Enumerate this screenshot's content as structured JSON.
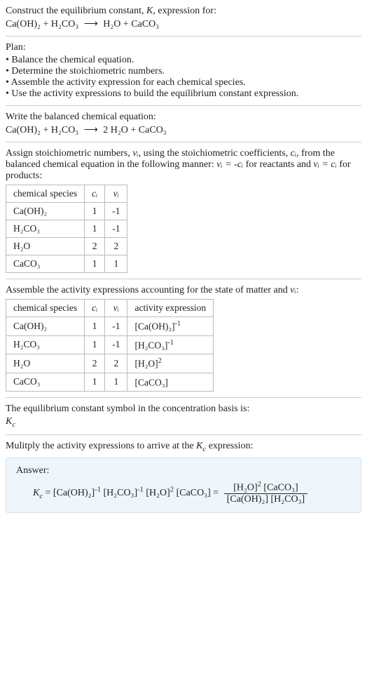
{
  "header": {
    "line1_pre": "Construct the equilibrium constant, ",
    "line1_K": "K",
    "line1_post": ", expression for:",
    "eq_lhs": "Ca(OH)₂ + H₂CO₃",
    "eq_arrow": "⟶",
    "eq_rhs": "H₂O + CaCO₃"
  },
  "plan": {
    "title": "Plan:",
    "items": [
      "Balance the chemical equation.",
      "Determine the stoichiometric numbers.",
      "Assemble the activity expression for each chemical species.",
      "Use the activity expressions to build the equilibrium constant expression."
    ]
  },
  "balanced": {
    "title": "Write the balanced chemical equation:",
    "eq_lhs": "Ca(OH)₂ + H₂CO₃",
    "eq_arrow": "⟶",
    "eq_rhs": "2 H₂O + CaCO₃"
  },
  "stoich": {
    "intro_a": "Assign stoichiometric numbers, ",
    "intro_nu": "νᵢ",
    "intro_b": ", using the stoichiometric coefficients, ",
    "intro_c": "cᵢ",
    "intro_d": ", from the balanced chemical equation in the following manner: ",
    "intro_eq1": "νᵢ = -cᵢ",
    "intro_e": " for reactants and ",
    "intro_eq2": "νᵢ = cᵢ",
    "intro_f": " for products:",
    "headers": {
      "species": "chemical species",
      "c": "cᵢ",
      "nu": "νᵢ"
    },
    "rows": [
      {
        "species": "Ca(OH)₂",
        "c": "1",
        "nu": "-1"
      },
      {
        "species": "H₂CO₃",
        "c": "1",
        "nu": "-1"
      },
      {
        "species": "H₂O",
        "c": "2",
        "nu": "2"
      },
      {
        "species": "CaCO₃",
        "c": "1",
        "nu": "1"
      }
    ]
  },
  "activity": {
    "intro_a": "Assemble the activity expressions accounting for the state of matter and ",
    "intro_nu": "νᵢ",
    "intro_b": ":",
    "headers": {
      "species": "chemical species",
      "c": "cᵢ",
      "nu": "νᵢ",
      "act": "activity expression"
    },
    "rows": [
      {
        "species": "Ca(OH)₂",
        "c": "1",
        "nu": "-1",
        "act_base": "[Ca(OH)₂]",
        "act_exp": "-1"
      },
      {
        "species": "H₂CO₃",
        "c": "1",
        "nu": "-1",
        "act_base": "[H₂CO₃]",
        "act_exp": "-1"
      },
      {
        "species": "H₂O",
        "c": "2",
        "nu": "2",
        "act_base": "[H₂O]",
        "act_exp": "2"
      },
      {
        "species": "CaCO₃",
        "c": "1",
        "nu": "1",
        "act_base": "[CaCO₃]",
        "act_exp": ""
      }
    ]
  },
  "symbol": {
    "line": "The equilibrium constant symbol in the concentration basis is:",
    "k": "K",
    "ksub": "c"
  },
  "multiply": {
    "line_a": "Mulitply the activity expressions to arrive at the ",
    "k": "K",
    "ksub": "c",
    "line_b": " expression:"
  },
  "answer": {
    "label": "Answer:",
    "k": "K",
    "ksub": "c",
    "eq": " = ",
    "t1_base": "[Ca(OH)₂]",
    "t1_exp": "-1",
    "t2_base": "[H₂CO₃]",
    "t2_exp": "-1",
    "t3_base": "[H₂O]",
    "t3_exp": "2",
    "t4_base": "[CaCO₃]",
    "t4_exp": "",
    "eq2": " = ",
    "num_a": "[H₂O]",
    "num_a_exp": "2",
    "num_b": " [CaCO₃]",
    "den": "[Ca(OH)₂] [H₂CO₃]"
  }
}
